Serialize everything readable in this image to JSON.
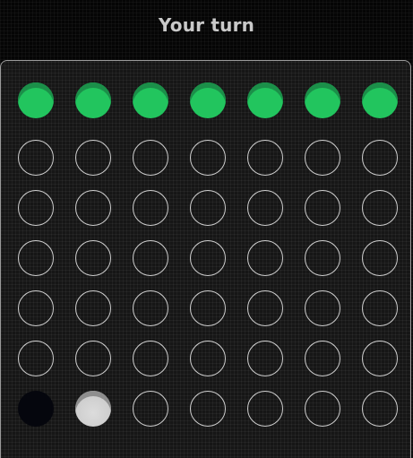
{
  "status": {
    "text": "Your turn"
  },
  "colors": {
    "drop_disc": "#22c55e",
    "empty_ring": "#cfcfcf",
    "dark_piece": "#05060d",
    "light_piece": "#cfcfcf",
    "board_border": "#9a9a9a"
  },
  "board": {
    "columns": 7,
    "rows": 6,
    "grid": [
      [
        "empty",
        "empty",
        "empty",
        "empty",
        "empty",
        "empty",
        "empty"
      ],
      [
        "empty",
        "empty",
        "empty",
        "empty",
        "empty",
        "empty",
        "empty"
      ],
      [
        "empty",
        "empty",
        "empty",
        "empty",
        "empty",
        "empty",
        "empty"
      ],
      [
        "empty",
        "empty",
        "empty",
        "empty",
        "empty",
        "empty",
        "empty"
      ],
      [
        "empty",
        "empty",
        "empty",
        "empty",
        "empty",
        "empty",
        "empty"
      ],
      [
        "dark",
        "light",
        "empty",
        "empty",
        "empty",
        "empty",
        "empty"
      ]
    ]
  }
}
